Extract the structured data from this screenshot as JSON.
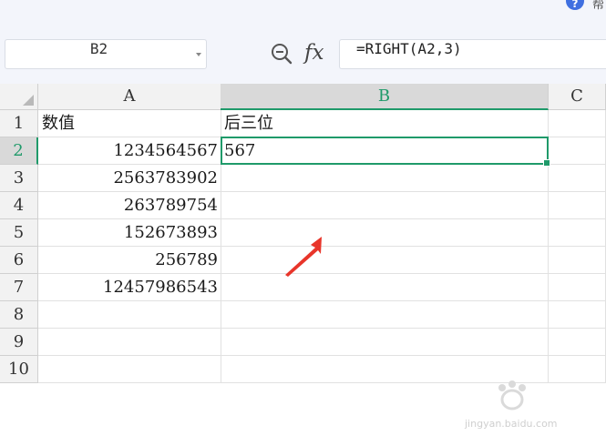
{
  "topbar": {
    "help_icon": "?",
    "partial_text": "帮"
  },
  "name_box": {
    "value": "B2",
    "dropdown_icon": "chevron-down-icon"
  },
  "formula_bar": {
    "zoom_icon": "zoom-out-icon",
    "fx_label": "fx",
    "formula": "=RIGHT(A2,3)"
  },
  "columns": [
    {
      "label": "A",
      "active": false
    },
    {
      "label": "B",
      "active": true
    },
    {
      "label": "C",
      "active": false
    }
  ],
  "rows": [
    {
      "num": "1",
      "a": "数值",
      "b": "后三位",
      "a_numeric": false
    },
    {
      "num": "2",
      "a": "1234564567",
      "b": "567",
      "a_numeric": true
    },
    {
      "num": "3",
      "a": "2563783902",
      "b": "",
      "a_numeric": true
    },
    {
      "num": "4",
      "a": "263789754",
      "b": "",
      "a_numeric": true
    },
    {
      "num": "5",
      "a": "152673893",
      "b": "",
      "a_numeric": true
    },
    {
      "num": "6",
      "a": "256789",
      "b": "",
      "a_numeric": true
    },
    {
      "num": "7",
      "a": "12457986543",
      "b": "",
      "a_numeric": true
    },
    {
      "num": "8",
      "a": "",
      "b": "",
      "a_numeric": false
    },
    {
      "num": "9",
      "a": "",
      "b": "",
      "a_numeric": false
    },
    {
      "num": "10",
      "a": "",
      "b": "",
      "a_numeric": false
    }
  ],
  "selection": {
    "cell": "B2",
    "active_row": "2",
    "active_col": "B"
  },
  "colors": {
    "accent": "#1f9a6a",
    "annotation": "#e8352a",
    "header_bg": "#f2f2f2"
  },
  "watermark": {
    "logo": "Bai du 经验",
    "url": "jingyan.baidu.com"
  }
}
